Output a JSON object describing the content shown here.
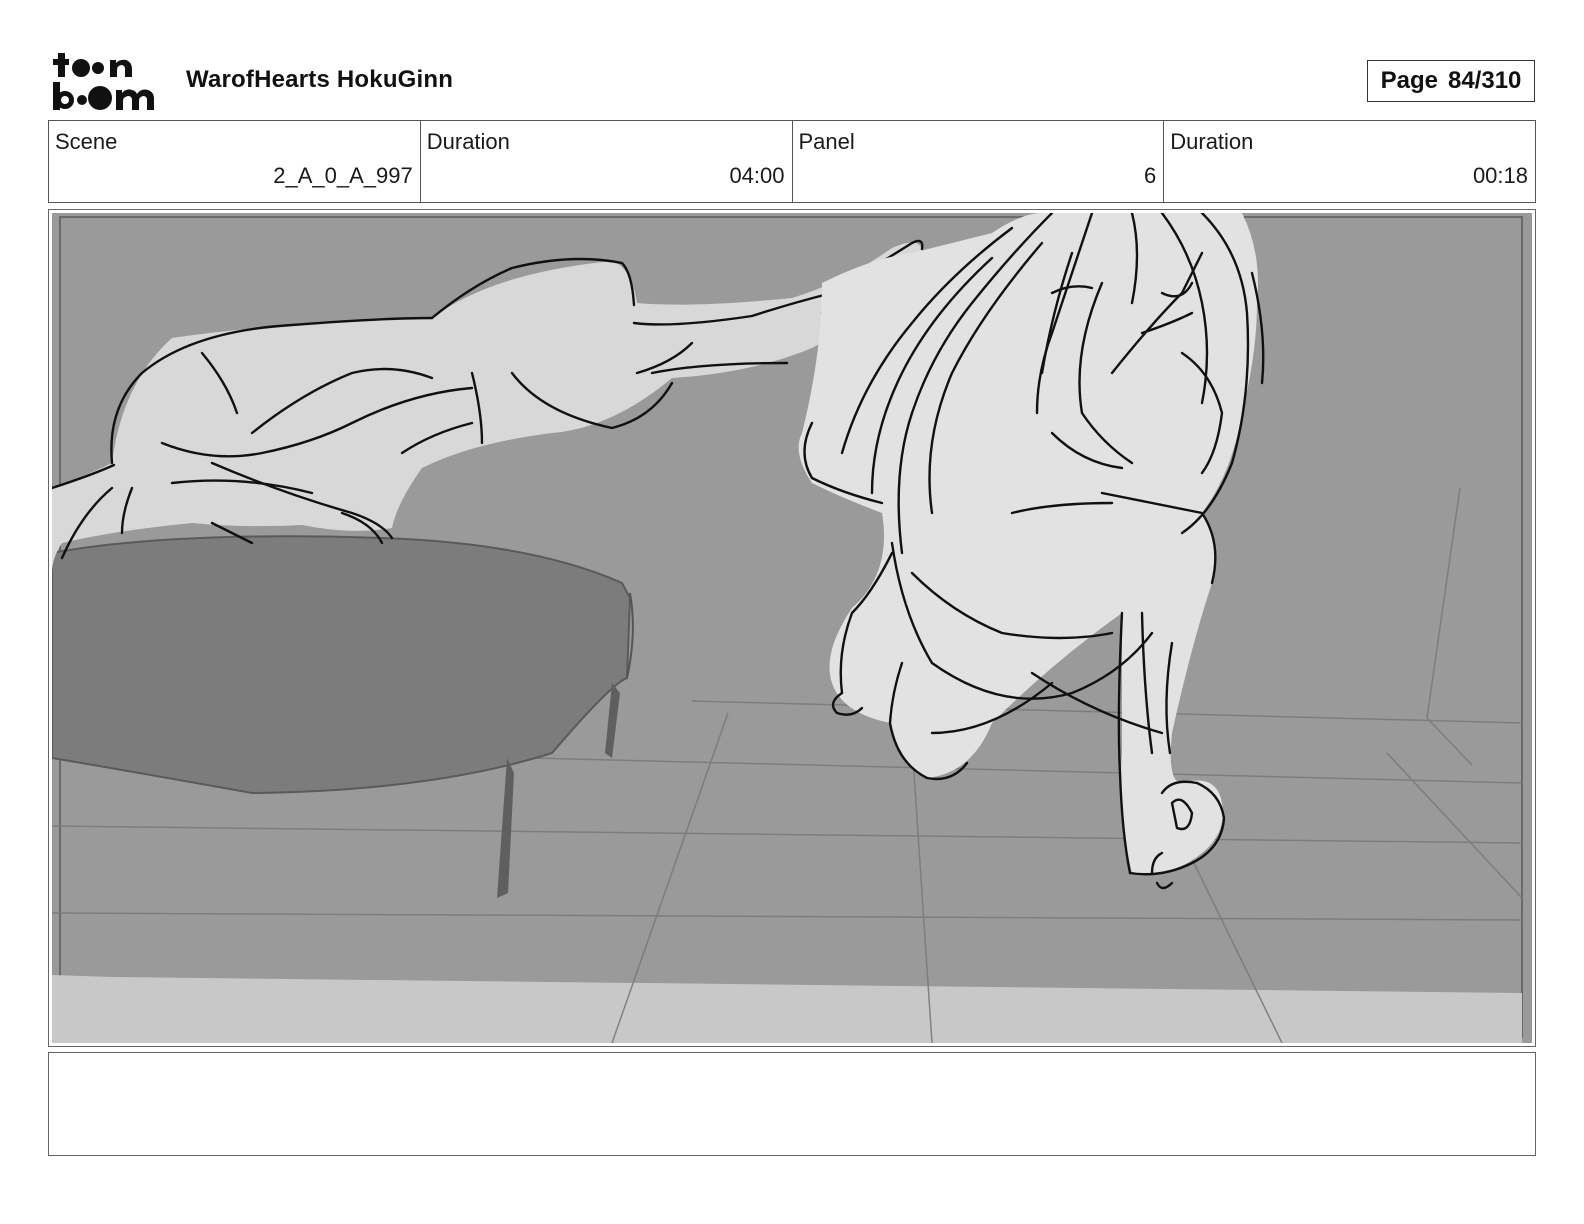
{
  "header": {
    "logo_text": "toon boom",
    "project_title": "WarofHearts HokuGinn",
    "page_label": "Page",
    "page_number": "84/310"
  },
  "info": {
    "scene_label": "Scene",
    "scene_value": "2_A_0_A_997",
    "scene_duration_label": "Duration",
    "scene_duration_value": "04:00",
    "panel_label": "Panel",
    "panel_value": "6",
    "panel_duration_label": "Duration",
    "panel_duration_value": "00:18"
  },
  "panel": {
    "sketch_description_icon": "storyboard-sketch"
  },
  "notes": {
    "text": ""
  },
  "colors": {
    "wall": "#999999",
    "floor_strip": "#c9c9c9",
    "bed": "#7d7d7d",
    "figure_fill": "#d8d8d8",
    "line": "#111111"
  }
}
